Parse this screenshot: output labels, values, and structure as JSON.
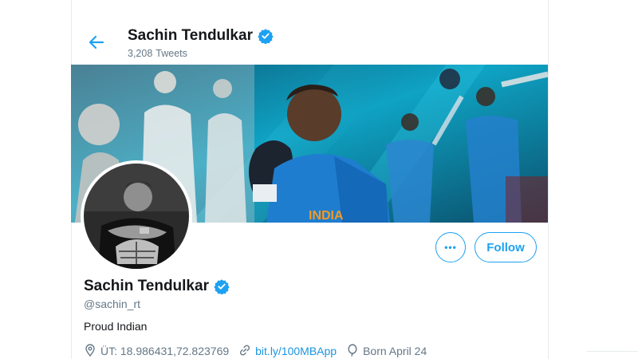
{
  "header": {
    "name": "Sachin Tendulkar",
    "tweet_count": "3,208",
    "tweet_label": "Tweets"
  },
  "banner": {
    "jersey_text": "INDIA"
  },
  "actions": {
    "more_label": "•••",
    "follow_label": "Follow"
  },
  "profile": {
    "name": "Sachin Tendulkar",
    "handle": "@sachin_rt",
    "bio": "Proud Indian",
    "location": "ÜT: 18.986431,72.823769",
    "website": "bit.ly/100MBApp",
    "born": "Born April 24"
  },
  "colors": {
    "accent": "#1da1f2",
    "link": "#1b95e0",
    "muted": "#657786",
    "verified": "#1da1f2"
  },
  "icons": {
    "back": "back-arrow-icon",
    "verified": "verified-badge-icon",
    "location": "location-pin-icon",
    "link": "link-icon",
    "birthday": "balloon-icon",
    "more": "more-dots-icon"
  }
}
